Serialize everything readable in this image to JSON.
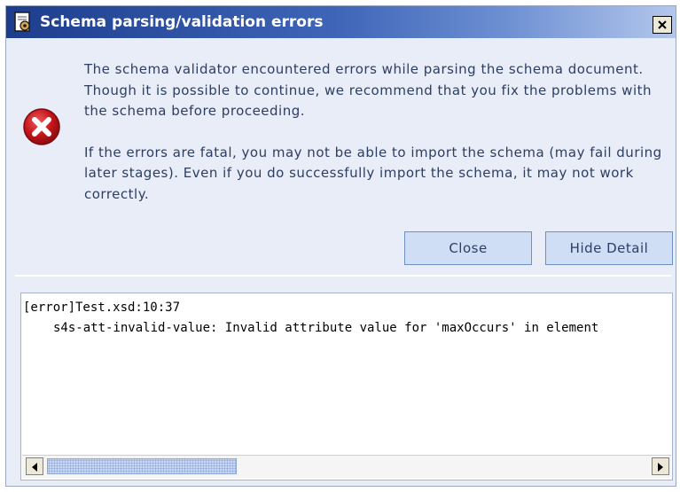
{
  "window": {
    "title": "Schema parsing/validation errors",
    "icon": "document-gear-icon",
    "close_glyph": "×"
  },
  "message": {
    "icon": "error-icon",
    "paragraph1": "The schema validator encountered errors while parsing the schema document. Though it is possible to continue, we recommend that you fix the problems with the schema before proceeding.",
    "paragraph2": "If the errors are fatal, you may not be able to import the schema (may fail during later stages). Even if you do successfully import the schema, it may not work correctly."
  },
  "buttons": {
    "close_label": "Close",
    "hide_detail_label": "Hide Detail"
  },
  "detail": {
    "line1": "[error]Test.xsd:10:37",
    "line2": "s4s-att-invalid-value: Invalid attribute value for 'maxOccurs' in element"
  },
  "colors": {
    "title_bar_start": "#1d3d8c",
    "title_bar_end": "#b3c7ec",
    "dialog_background": "#e8edf7",
    "button_background": "#cfddf5",
    "text": "#2c3e63",
    "error_red": "#c4161c"
  }
}
